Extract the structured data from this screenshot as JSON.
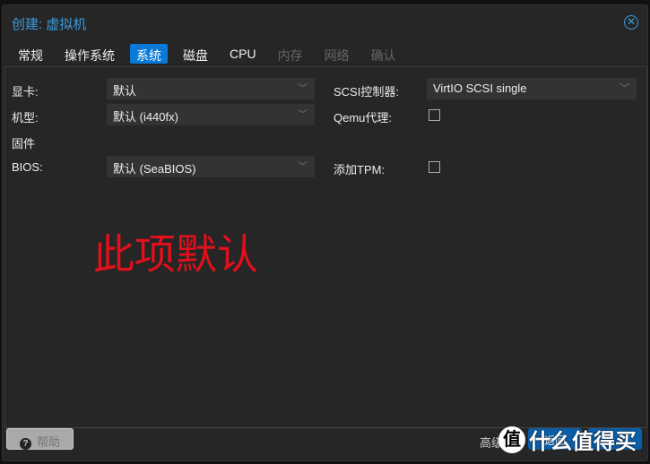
{
  "window": {
    "title": "创建: 虚拟机",
    "close_icon": "close-circle-icon"
  },
  "tabs": [
    {
      "label": "常规",
      "state": "normal"
    },
    {
      "label": "操作系统",
      "state": "normal"
    },
    {
      "label": "系统",
      "state": "active"
    },
    {
      "label": "磁盘",
      "state": "normal"
    },
    {
      "label": "CPU",
      "state": "normal"
    },
    {
      "label": "内存",
      "state": "disabled"
    },
    {
      "label": "网络",
      "state": "disabled"
    },
    {
      "label": "确认",
      "state": "disabled"
    }
  ],
  "form": {
    "graphics": {
      "label": "显卡:",
      "value": "默认"
    },
    "machine": {
      "label": "机型:",
      "value": "默认 (i440fx)"
    },
    "firmware_heading": "固件",
    "bios": {
      "label": "BIOS:",
      "value": "默认 (SeaBIOS)"
    },
    "scsi": {
      "label": "SCSI控制器:",
      "value": "VirtIO SCSI single"
    },
    "qemu_agent": {
      "label": "Qemu代理:",
      "checked": false
    },
    "tpm": {
      "label": "添加TPM:",
      "checked": false
    }
  },
  "annotation": "此项默认",
  "annotation_color": "#e0101c",
  "footer": {
    "help": "帮助",
    "advanced": "高级",
    "back": "返回"
  },
  "watermark": {
    "badge": "值",
    "text": "什么值得买"
  },
  "accent_color": "#0a7ad8"
}
